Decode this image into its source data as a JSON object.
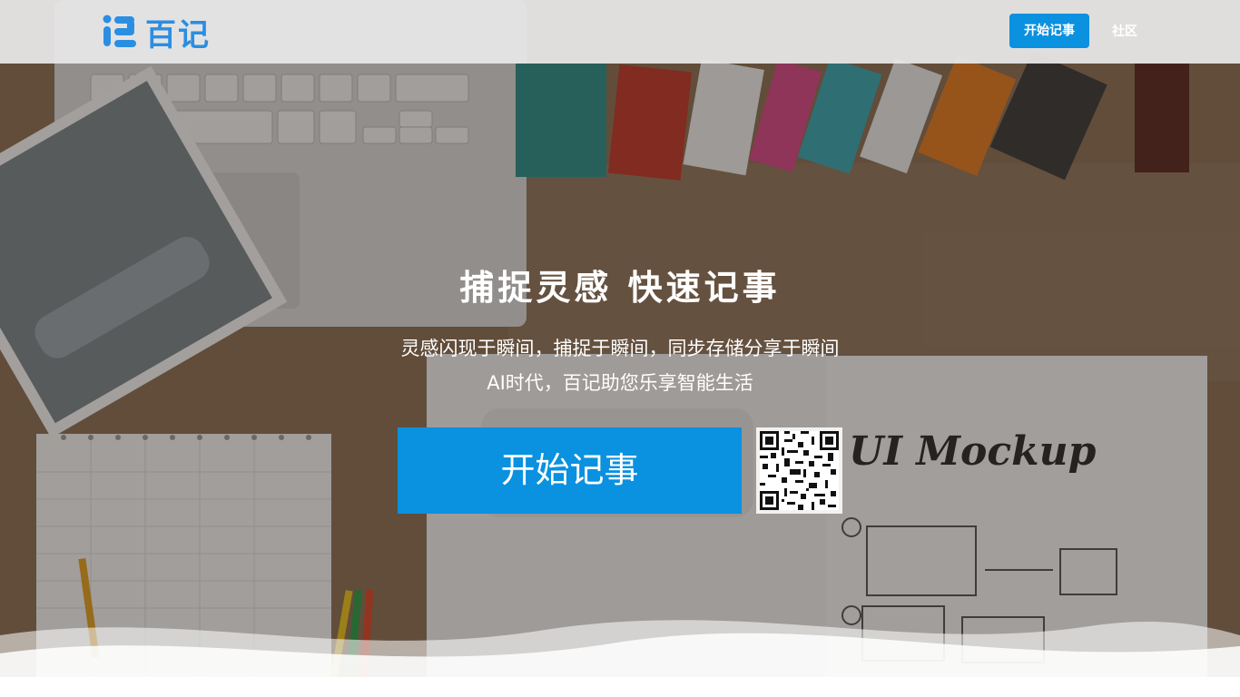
{
  "header": {
    "logo_text": "百记",
    "start_button": "开始记事",
    "community_link": "社区"
  },
  "hero": {
    "headline": "捕捉灵感 快速记事",
    "subtitle_line1": "灵感闪现于瞬间，捕捉于瞬间，同步存储分享于瞬间",
    "subtitle_line2": "AI时代，百记助您乐享智能生活",
    "cta_label": "开始记事",
    "qr_icon": "qr-code-icon",
    "notebook_text": "UI Mockup"
  },
  "colors": {
    "accent": "#0a91e0",
    "logo": "#2a8ee3"
  }
}
